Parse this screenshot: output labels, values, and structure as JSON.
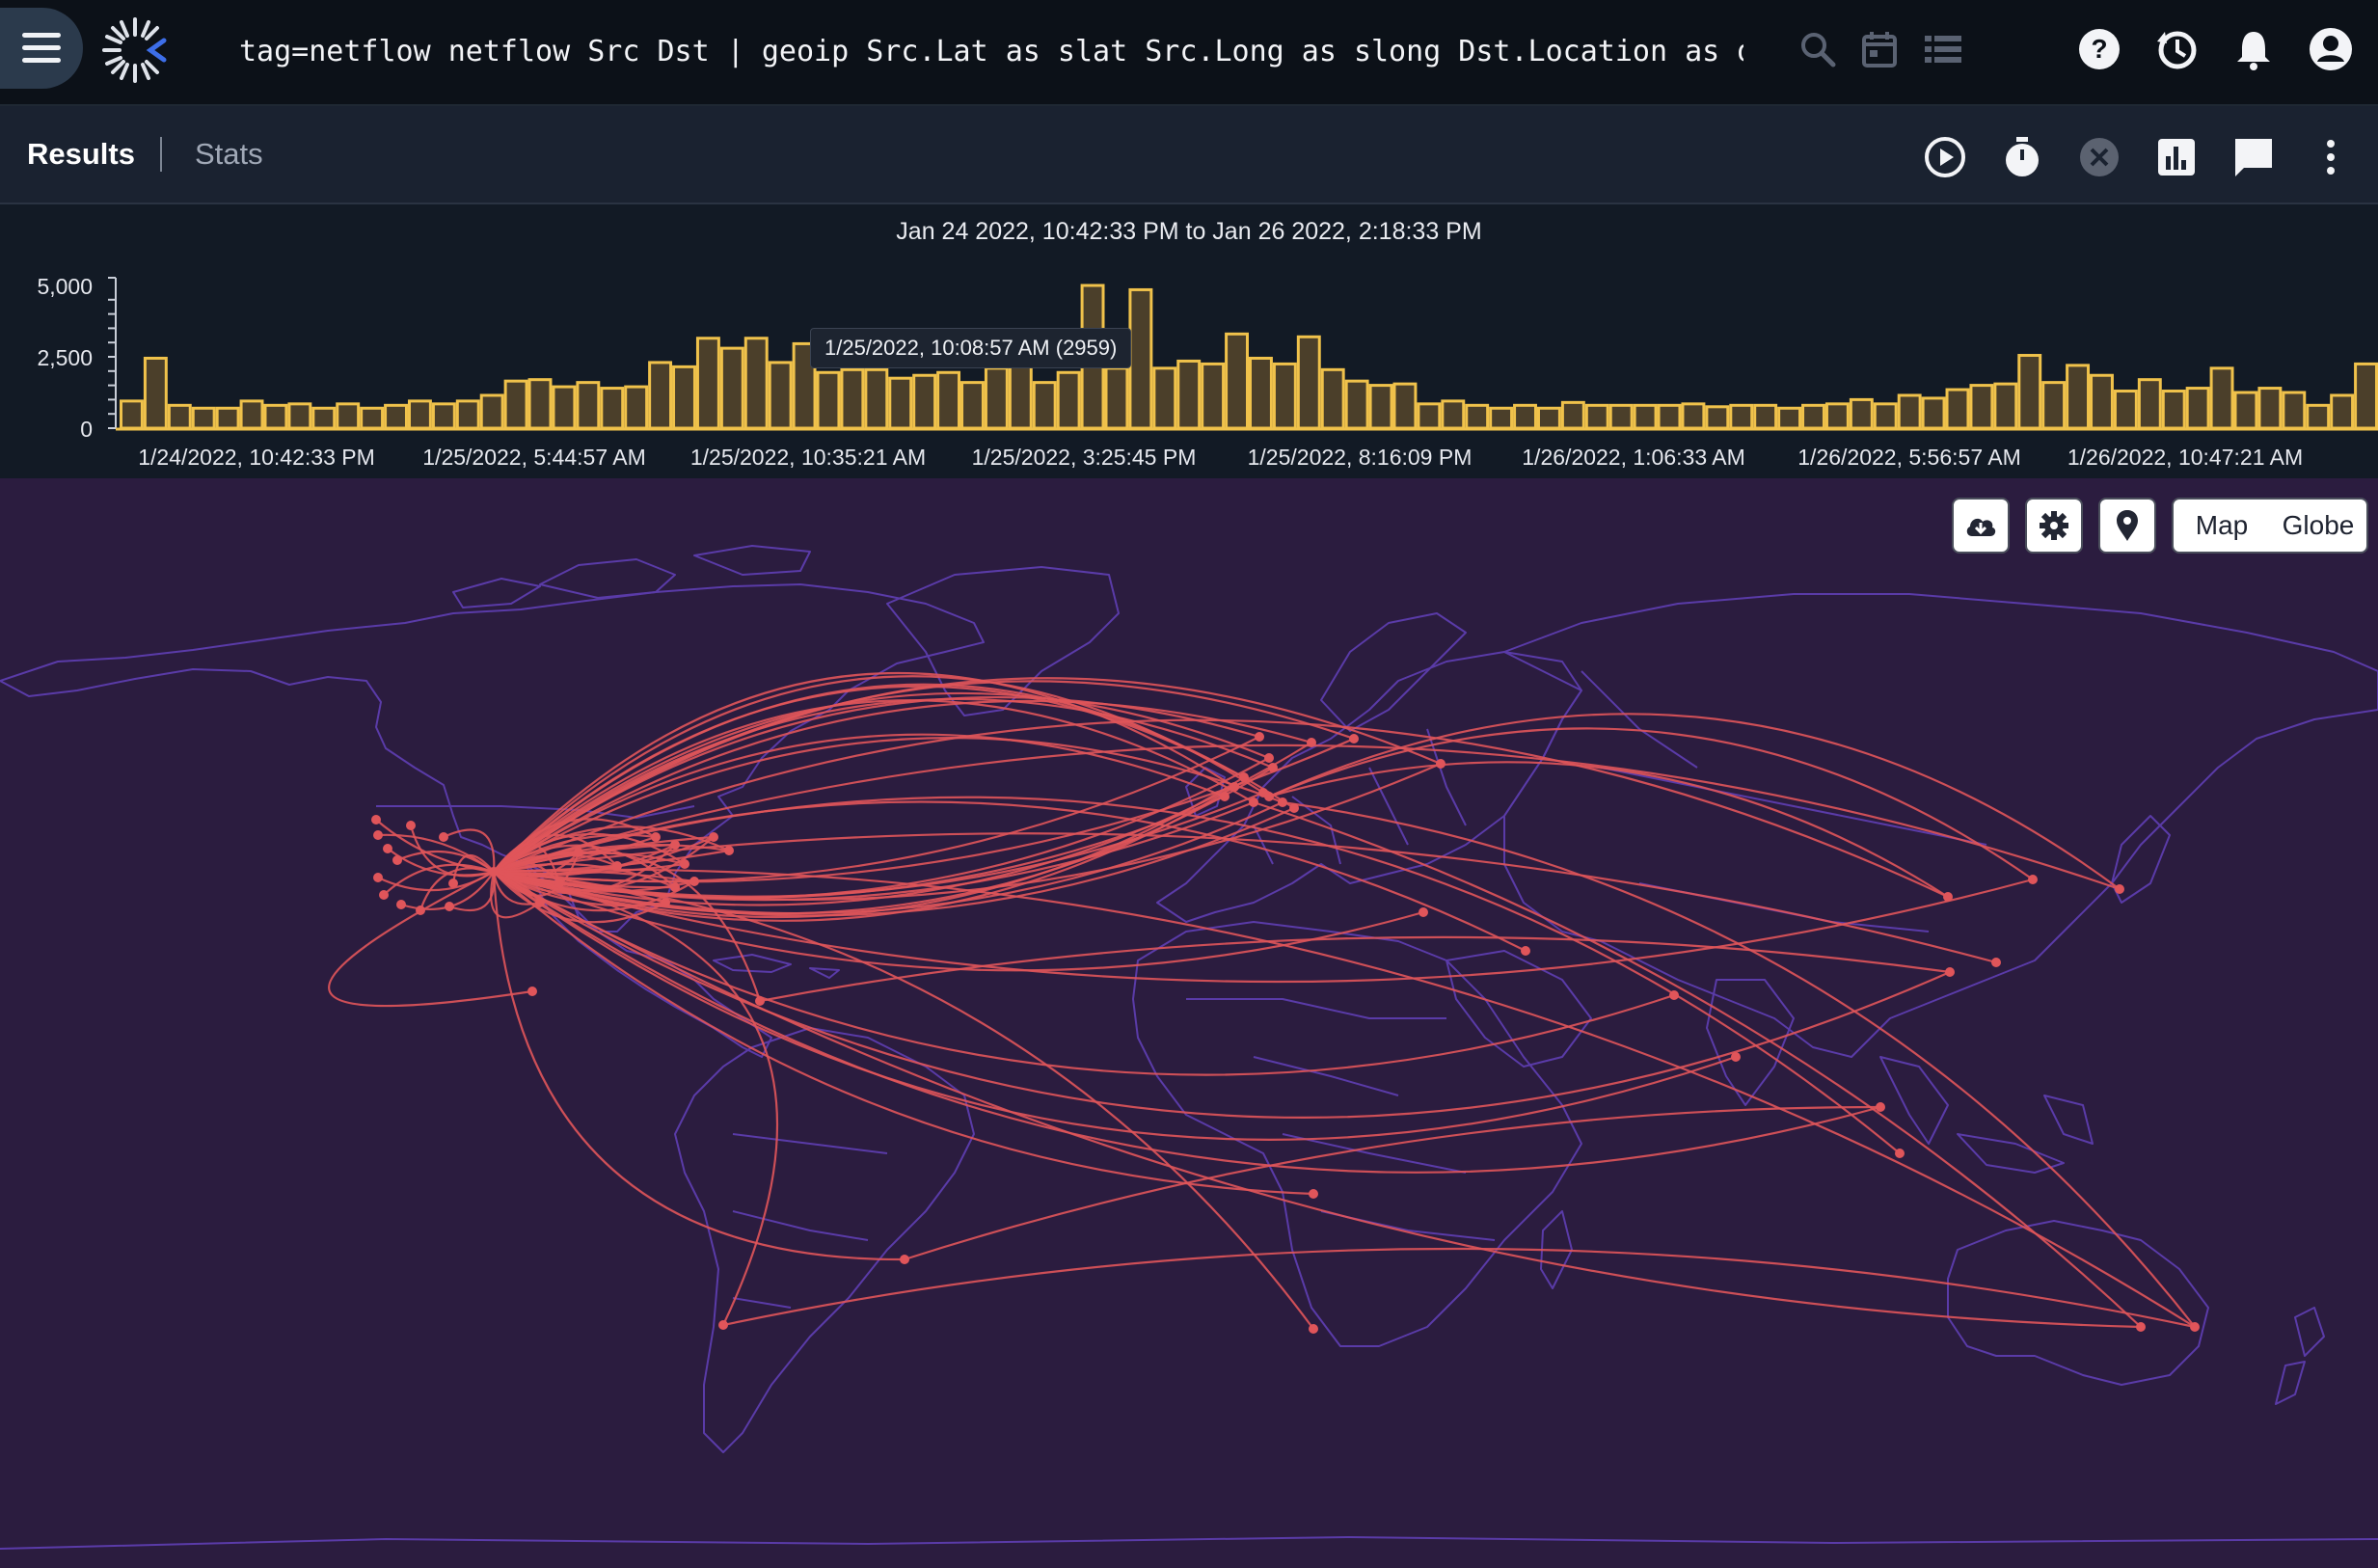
{
  "app": {
    "query": "tag=netflow netflow Src Dst | geoip Src.Lat as slat Src.Long as slong Dst.Location as dst |…"
  },
  "topbar": {
    "icons": [
      "menu-icon",
      "app-logo",
      "search-icon",
      "calendar-icon",
      "list-icon",
      "help-icon",
      "history-icon",
      "notification-bell-icon",
      "account-icon"
    ]
  },
  "tabs": {
    "results": "Results",
    "stats": "Stats"
  },
  "toolbar": {
    "icons": [
      "play-icon",
      "timer-icon",
      "cancel-icon",
      "bar-chart-icon",
      "comment-icon",
      "more-vertical-icon"
    ]
  },
  "histogram": {
    "range": "Jan 24 2022, 10:42:33 PM to Jan 26 2022, 2:18:33 PM",
    "tooltip": "1/25/2022, 10:08:57 AM (2959)",
    "y_ticks": [
      "5,000",
      "2,500",
      "0"
    ],
    "x_ticks": [
      "1/24/2022, 10:42:33 PM",
      "1/25/2022, 5:44:57 AM",
      "1/25/2022, 10:35:21 AM",
      "1/25/2022, 3:25:45 PM",
      "1/25/2022, 8:16:09 PM",
      "1/26/2022, 1:06:33 AM",
      "1/26/2022, 5:56:57 AM",
      "1/26/2022, 10:47:21 AM"
    ],
    "ylim": [
      0,
      5000
    ],
    "values": [
      950,
      2450,
      800,
      700,
      700,
      950,
      800,
      850,
      700,
      850,
      700,
      800,
      950,
      850,
      950,
      1150,
      1650,
      1700,
      1450,
      1600,
      1400,
      1450,
      2300,
      2150,
      3150,
      2800,
      3150,
      2300,
      2959,
      1950,
      2050,
      2050,
      1750,
      1850,
      1950,
      1600,
      2100,
      2350,
      1600,
      1950,
      5000,
      2100,
      4850,
      2100,
      2350,
      2250,
      3300,
      2450,
      2250,
      3200,
      2050,
      1650,
      1500,
      1550,
      850,
      950,
      800,
      700,
      800,
      700,
      900,
      800,
      800,
      800,
      800,
      850,
      750,
      800,
      800,
      700,
      800,
      850,
      1000,
      850,
      1150,
      1050,
      1350,
      1500,
      1550,
      2550,
      1600,
      2200,
      1850,
      1300,
      1700,
      1300,
      1400,
      2100,
      1250,
      1400,
      1250,
      800,
      1150,
      2250
    ],
    "bar_color": "#f0c24b",
    "bar_fill": "#4b3f2a"
  },
  "map": {
    "controls": {
      "download_icon": "cloud-download-icon",
      "settings_icon": "gear-icon",
      "marker_icon": "map-pin-icon",
      "map_label": "Map",
      "globe_label": "Globe"
    },
    "colors": {
      "background": "#2b1c3f",
      "land_outline": "#5a3ba8",
      "flow": "#e0555a"
    }
  }
}
